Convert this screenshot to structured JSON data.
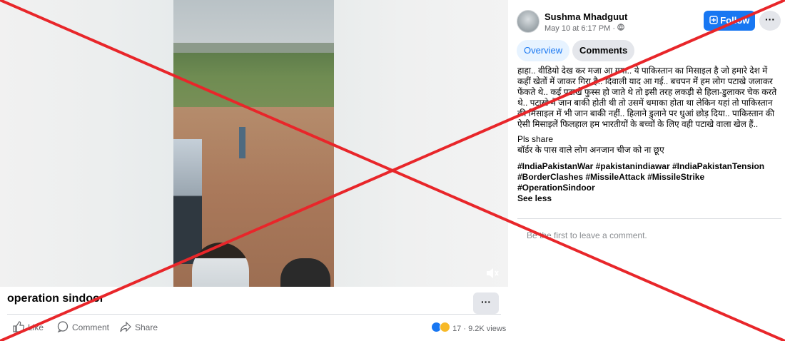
{
  "post": {
    "title": "operation sindoor",
    "more_label": "···",
    "actions": {
      "like": "Like",
      "comment": "Comment",
      "share": "Share"
    },
    "reactions_count": "17",
    "views": "9.2K views"
  },
  "author": {
    "name": "Sushma Mhadguut",
    "timestamp": "May 10 at 6:17 PM ·"
  },
  "header": {
    "follow_label": "Follow",
    "more_label": "···"
  },
  "tabs": [
    {
      "label": "Overview"
    },
    {
      "label": "Comments"
    }
  ],
  "description": {
    "line1": "हाहा.. वीडियो देख कर मजा आ गया.. ये पाकिस्तान का मिसाइल है जो हमारे देश में कहीं खेतों में जाकर गिरा है.. दिवाली याद आ गई.. बचपन में हम लोग पटाखे जलाकर फेंकते थे.. कई पटाखे फुस्स हो जाते थे तो इसी तरह लकड़ी से हिला-डुलाकर चेक करते थे.. पटाखे में जान बाकी होती थी तो उसमें धमाका होता था लेकिन यहां तो पाकिस्तान की मिसाइल में भी जान बाकी नहीं.. हिलाने डुलाने पर धुआं छोड़ दिया.. पाकिस्तान की ऐसी मिसाइलें फिलहाल हम भारतीयों के बच्चों के लिए वही पटाखे वाला खेल हैं..",
    "line2": "Pls share",
    "line3": "बॉर्डर के पास वाले लोग अनजान चीज को ना छूए",
    "hashtags": "#IndiaPakistanWar #pakistanindiawar #IndiaPakistanTension #BorderClashes #MissileAttack #MissileStrike #OperationSindoor",
    "see_less": "See less"
  },
  "comments": {
    "empty_text": "Be the first to leave a comment."
  },
  "colors": {
    "accent": "#1877f2",
    "cross": "#e8262a"
  },
  "icons": {
    "like": "thumbs-up-icon",
    "comment": "speech-bubble-icon",
    "share": "share-arrow-icon",
    "mute": "speaker-muted-icon",
    "globe": "globe-icon"
  }
}
